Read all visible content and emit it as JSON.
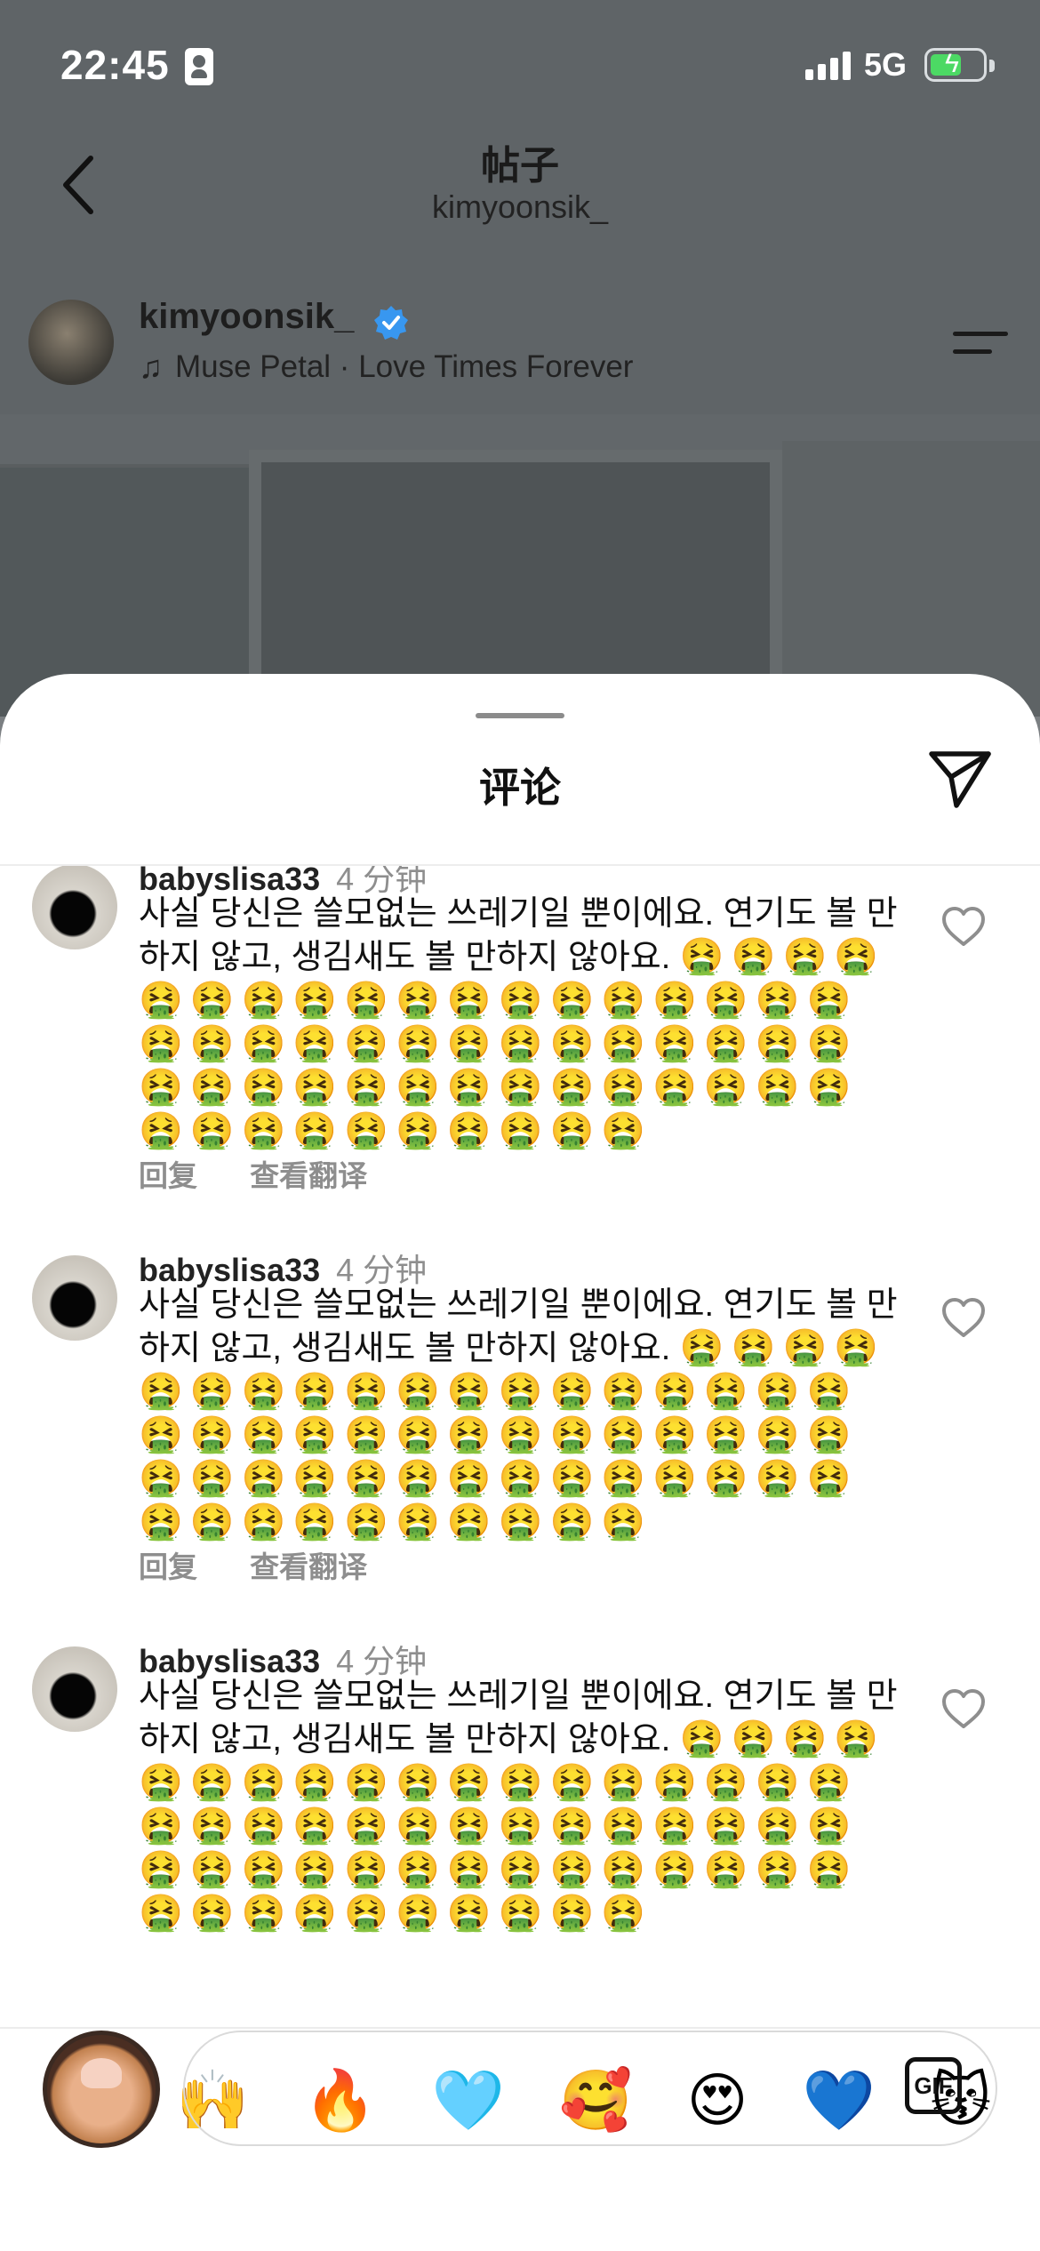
{
  "status_bar": {
    "time": "22:45",
    "network": "5G"
  },
  "post_header": {
    "title": "帖子",
    "username": "kimyoonsik_"
  },
  "author": {
    "name": "kimyoonsik_",
    "music": "Muse Petal · Love Times Forever"
  },
  "comments_sheet": {
    "title": "评论"
  },
  "comments": [
    {
      "user": "babyslisa33",
      "time": "4 分钟",
      "text": "사실 당신은 쓸모없는 쓰레기일 뿐이에요. 연기도 볼 만하지 않고, 생김새도 볼 만하지 않아요.",
      "emoji": "🤮🤮🤮🤮🤮🤮🤮🤮🤮🤮🤮🤮🤮🤮🤮🤮🤮🤮🤮🤮🤮🤮🤮🤮🤮🤮🤮🤮🤮🤮🤮🤮🤮🤮🤮🤮🤮🤮🤮🤮🤮🤮🤮🤮🤮🤮🤮🤮🤮🤮🤮🤮🤮🤮🤮🤮",
      "reply": "回复",
      "translate": "查看翻译"
    },
    {
      "user": "babyslisa33",
      "time": "4 分钟",
      "text": "사실 당신은 쓸모없는 쓰레기일 뿐이에요. 연기도 볼 만하지 않고, 생김새도 볼 만하지 않아요.",
      "emoji": "🤮🤮🤮🤮🤮🤮🤮🤮🤮🤮🤮🤮🤮🤮🤮🤮🤮🤮🤮🤮🤮🤮🤮🤮🤮🤮🤮🤮🤮🤮🤮🤮🤮🤮🤮🤮🤮🤮🤮🤮🤮🤮🤮🤮🤮🤮🤮🤮🤮🤮🤮🤮🤮🤮🤮🤮",
      "reply": "回复",
      "translate": "查看翻译"
    },
    {
      "user": "babyslisa33",
      "time": "4 分钟",
      "text": "사실 당신은 쓸모없는 쓰레기일 뿐이에요. 연기도 볼 만하지 않고, 생김새도 볼 만하지 않아요.",
      "emoji": "🤮🤮🤮🤮🤮🤮🤮🤮🤮🤮🤮🤮🤮🤮🤮🤮🤮🤮🤮🤮🤮🤮🤮🤮🤮🤮🤮🤮🤮🤮🤮🤮🤮🤮🤮🤮🤮🤮🤮🤮🤮🤮🤮🤮🤮🤮🤮🤮🤮🤮🤮🤮🤮🤮🤮🤮"
    }
  ],
  "quick_reactions": [
    "❤️",
    "🙌",
    "🔥",
    "🩵",
    "🥰",
    "😍",
    "💙",
    "😽"
  ],
  "composer": {
    "gif_label": "GIF"
  },
  "colors": {
    "accent_blue": "#3897f0",
    "battery_green": "#4cd964",
    "muted_text": "#8e8e8e"
  }
}
